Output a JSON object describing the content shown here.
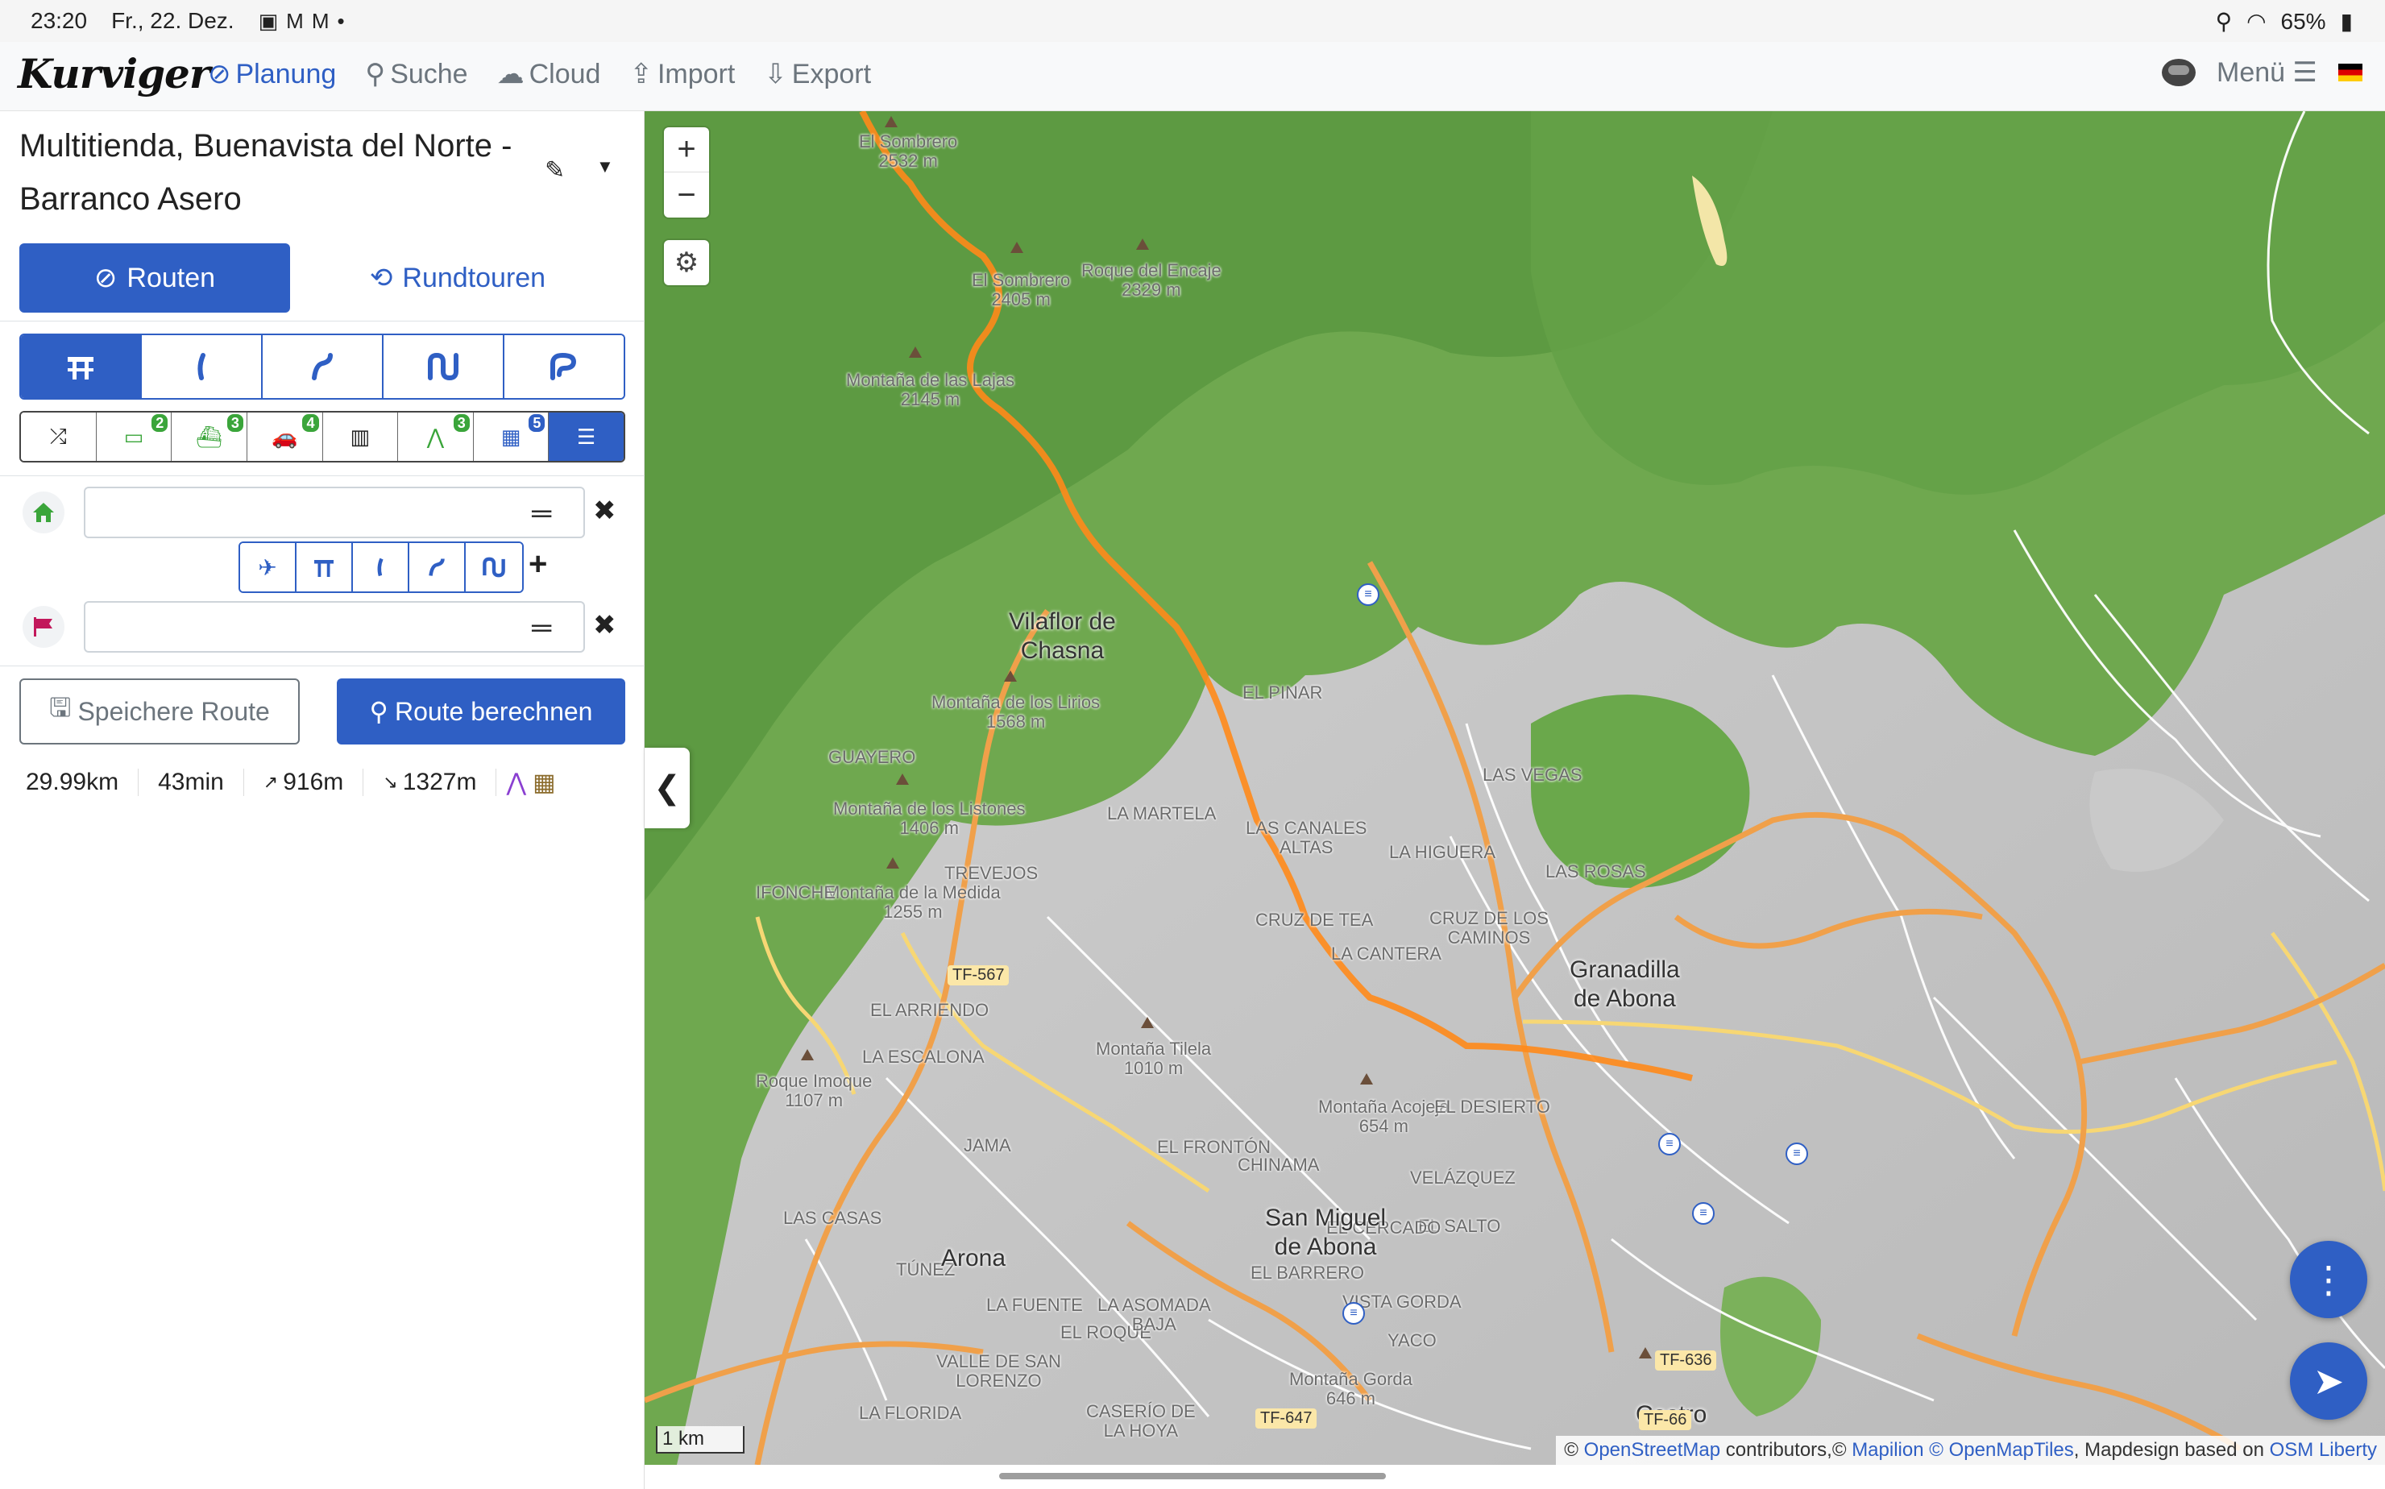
{
  "status_bar": {
    "time": "23:20",
    "date": "Fr., 22. Dez.",
    "battery": "65%",
    "notification_icons": [
      "image-icon",
      "gmail-icon",
      "gmail-icon",
      "dot-icon"
    ]
  },
  "navbar": {
    "logo": "Kurviger",
    "items": [
      {
        "label": "Planung",
        "icon": "compass-icon",
        "active": true
      },
      {
        "label": "Suche",
        "icon": "search-icon"
      },
      {
        "label": "Cloud",
        "icon": "cloud-icon"
      },
      {
        "label": "Import",
        "icon": "upload-icon"
      },
      {
        "label": "Export",
        "icon": "download-icon"
      }
    ],
    "menu_label": "Menü",
    "language": "de"
  },
  "sidebar": {
    "route_title": "Multitienda, Buenavista del Norte - Barranco Asero",
    "tabs": {
      "routes": "Routen",
      "roundtrips": "Rundtouren"
    },
    "road_types": [
      "fastest-icon",
      "curvy-icon",
      "curvier-icon",
      "curviest-icon",
      "extreme-curvy-icon"
    ],
    "options": [
      {
        "icon": "shuffle-icon",
        "badge": ""
      },
      {
        "icon": "toll-icon",
        "badge": "2"
      },
      {
        "icon": "ferry-icon",
        "badge": "3"
      },
      {
        "icon": "car-icon",
        "badge": "4"
      },
      {
        "icon": "unpaved-road-icon",
        "badge": ""
      },
      {
        "icon": "narrow-road-icon",
        "badge": "3"
      },
      {
        "icon": "region-icon",
        "badge": "5"
      },
      {
        "icon": "sliders-icon",
        "badge": ""
      }
    ],
    "waypoints": {
      "start": {
        "value": "",
        "placeholder": ""
      },
      "end": {
        "value": "",
        "placeholder": ""
      }
    },
    "via_types": [
      "plane-icon",
      "fastest-icon",
      "curvy-icon",
      "curvier-icon",
      "curviest-icon"
    ],
    "save_button": "Speichere Route",
    "calc_button": "Route berechnen",
    "stats": {
      "distance": "29.99km",
      "duration": "43min",
      "ascent": "916m",
      "descent": "1327m"
    }
  },
  "map": {
    "scale": "1 km",
    "attribution": {
      "osm": "OpenStreetMap",
      "contributors": " contributors,©",
      "mapilion": "Mapilion",
      "omt": "© OpenMapTiles",
      "design": ", Mapdesign based on",
      "liberty": "OSM Liberty"
    },
    "towns": [
      {
        "name": "Vilaflor de\nChasna"
      },
      {
        "name": "Granadilla\nde Abona"
      },
      {
        "name": "San Miguel\nde Abona"
      },
      {
        "name": "Arona"
      },
      {
        "name": "Castro"
      }
    ],
    "places": [
      "El Sombrero\n2532 m",
      "El Sombrero\n2405 m",
      "Roque del Encaje\n2329 m",
      "Montaña de las Lajas\n2145 m",
      "Montaña de los Lirios\n1568 m",
      "GUAYERO",
      "Montaña de los Listones\n1406 m",
      "Montaña de la Medida\n1255 m",
      "IFONCHE",
      "TREVEJOS",
      "EL ARRIENDO",
      "LA ESCALONA",
      "Roque Imoque\n1107 m",
      "LAS CASAS",
      "TÚNEZ",
      "LA FUENTE",
      "VALLE DE SAN\nLORENZO",
      "LA FLORIDA",
      "CASERÍO DE\nLA HOYA",
      "EL ROQUE",
      "LA ASOMADA\nBAJA",
      "JAMA",
      "Montaña Tilela\n1010 m",
      "EL FRONTÓN",
      "CHINAMA",
      "EL PINAR",
      "LA MARTELA",
      "LAS CANALES\nALTAS",
      "CRUZ DE TEA",
      "LA HIGUERA",
      "LAS VEGAS",
      "LAS ROSAS",
      "LA CANTERA",
      "CRUZ DE LOS\nCAMINOS",
      "Montaña Acojeja\n654 m",
      "EL DESIERTO",
      "VELÁZQUEZ",
      "EL SALTO",
      "EL CERCADO",
      "EL BARRERO",
      "VISTA GORDA",
      "YACO",
      "Montaña Gorda\n646 m"
    ],
    "road_labels": [
      "TF-567",
      "TF-66",
      "TF-647",
      "TF-636"
    ]
  }
}
